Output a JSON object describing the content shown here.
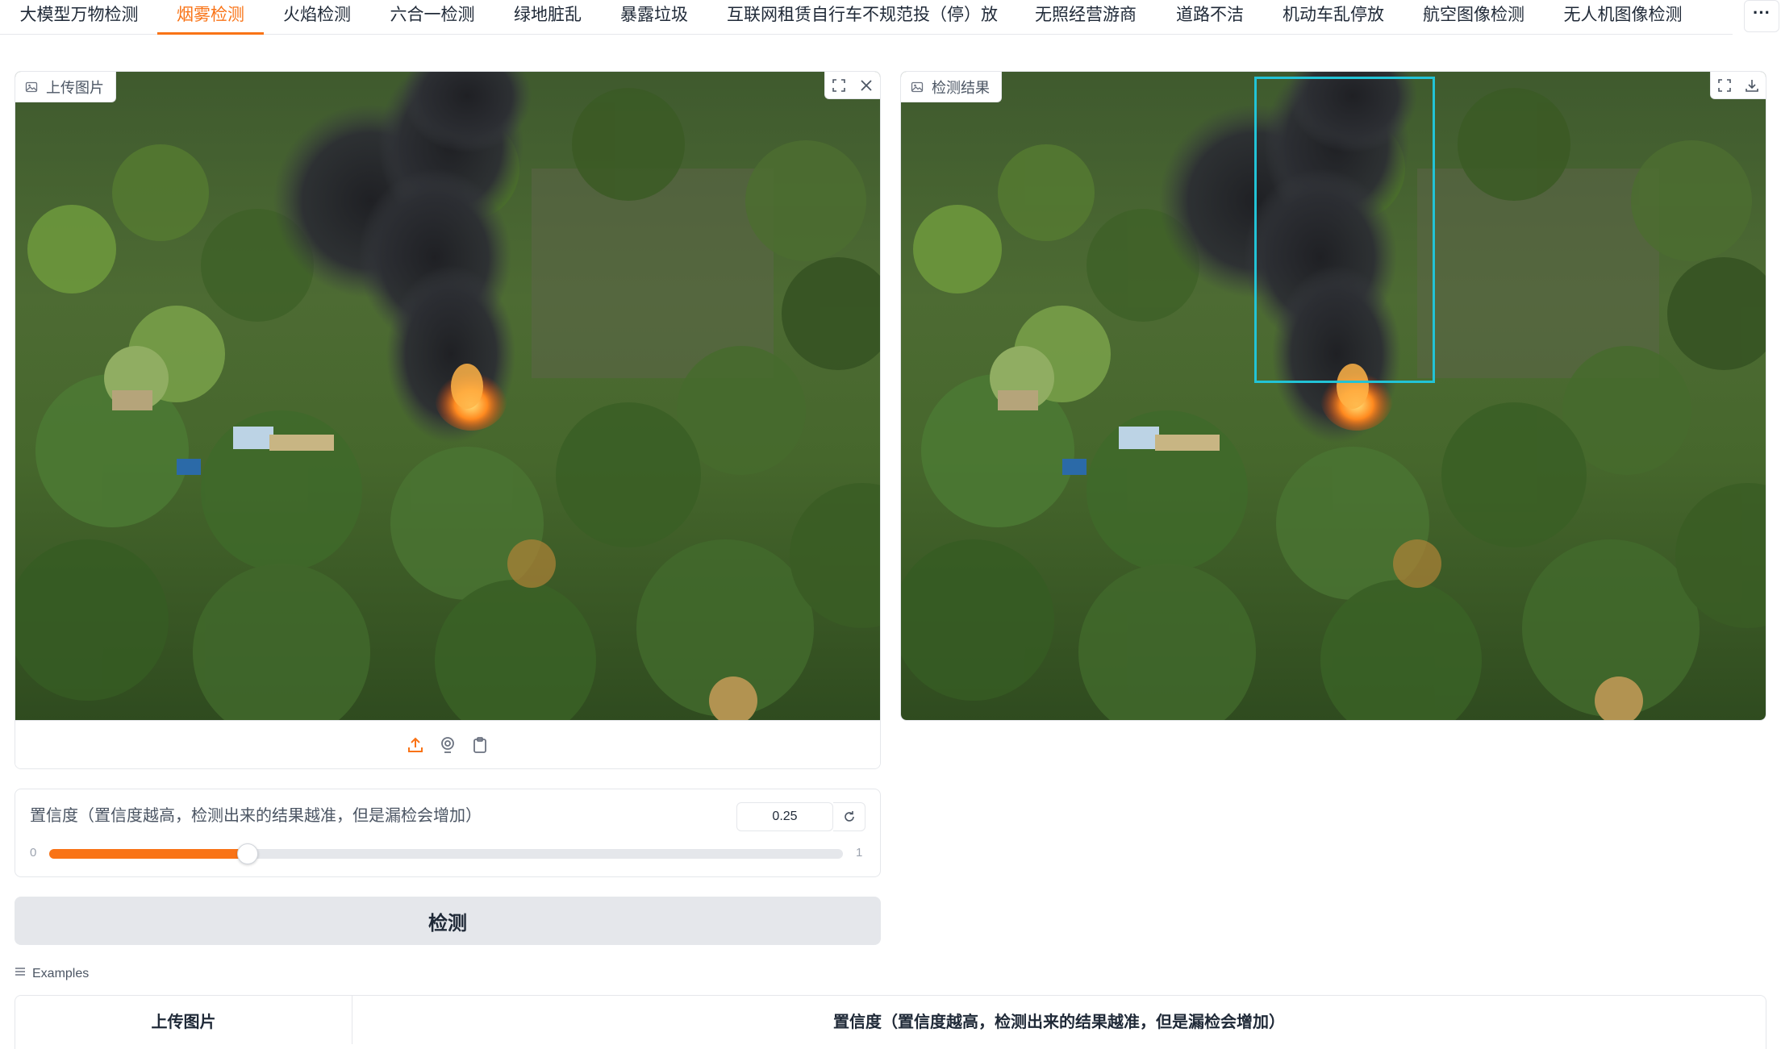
{
  "tabs": [
    {
      "label": "大模型万物检测",
      "active": false
    },
    {
      "label": "烟雾检测",
      "active": true
    },
    {
      "label": "火焰检测",
      "active": false
    },
    {
      "label": "六合一检测",
      "active": false
    },
    {
      "label": "绿地脏乱",
      "active": false
    },
    {
      "label": "暴露垃圾",
      "active": false
    },
    {
      "label": "互联网租赁自行车不规范投（停）放",
      "active": false
    },
    {
      "label": "无照经营游商",
      "active": false
    },
    {
      "label": "道路不洁",
      "active": false
    },
    {
      "label": "机动车乱停放",
      "active": false
    },
    {
      "label": "航空图像检测",
      "active": false
    },
    {
      "label": "无人机图像检测",
      "active": false
    }
  ],
  "more_label": "···",
  "upload_panel": {
    "label": "上传图片",
    "icon": "image-icon",
    "tools": [
      "fullscreen-icon",
      "close-icon"
    ],
    "sources": [
      "upload-icon",
      "webcam-icon",
      "clipboard-icon"
    ],
    "image_desc_icon": "wildfire-smoke-photo"
  },
  "result_panel": {
    "label": "检测结果",
    "icon": "image-icon",
    "tools": [
      "fullscreen-icon",
      "download-icon"
    ],
    "box_color": "#22c3d6"
  },
  "confidence": {
    "label": "置信度（置信度越高，检测出来的结果越准，但是漏检会增加）",
    "value": "0.25",
    "fraction": 0.25,
    "min": "0",
    "max": "1",
    "reset_icon": "reset-icon"
  },
  "detect_button": {
    "label": "检测"
  },
  "examples": {
    "title": "Examples",
    "icon": "list-icon",
    "columns": [
      "上传图片",
      "置信度（置信度越高，检测出来的结果越准，但是漏检会增加）"
    ]
  },
  "colors": {
    "accent": "#f97316",
    "border": "#e5e7eb",
    "button_bg": "#e5e7eb"
  }
}
